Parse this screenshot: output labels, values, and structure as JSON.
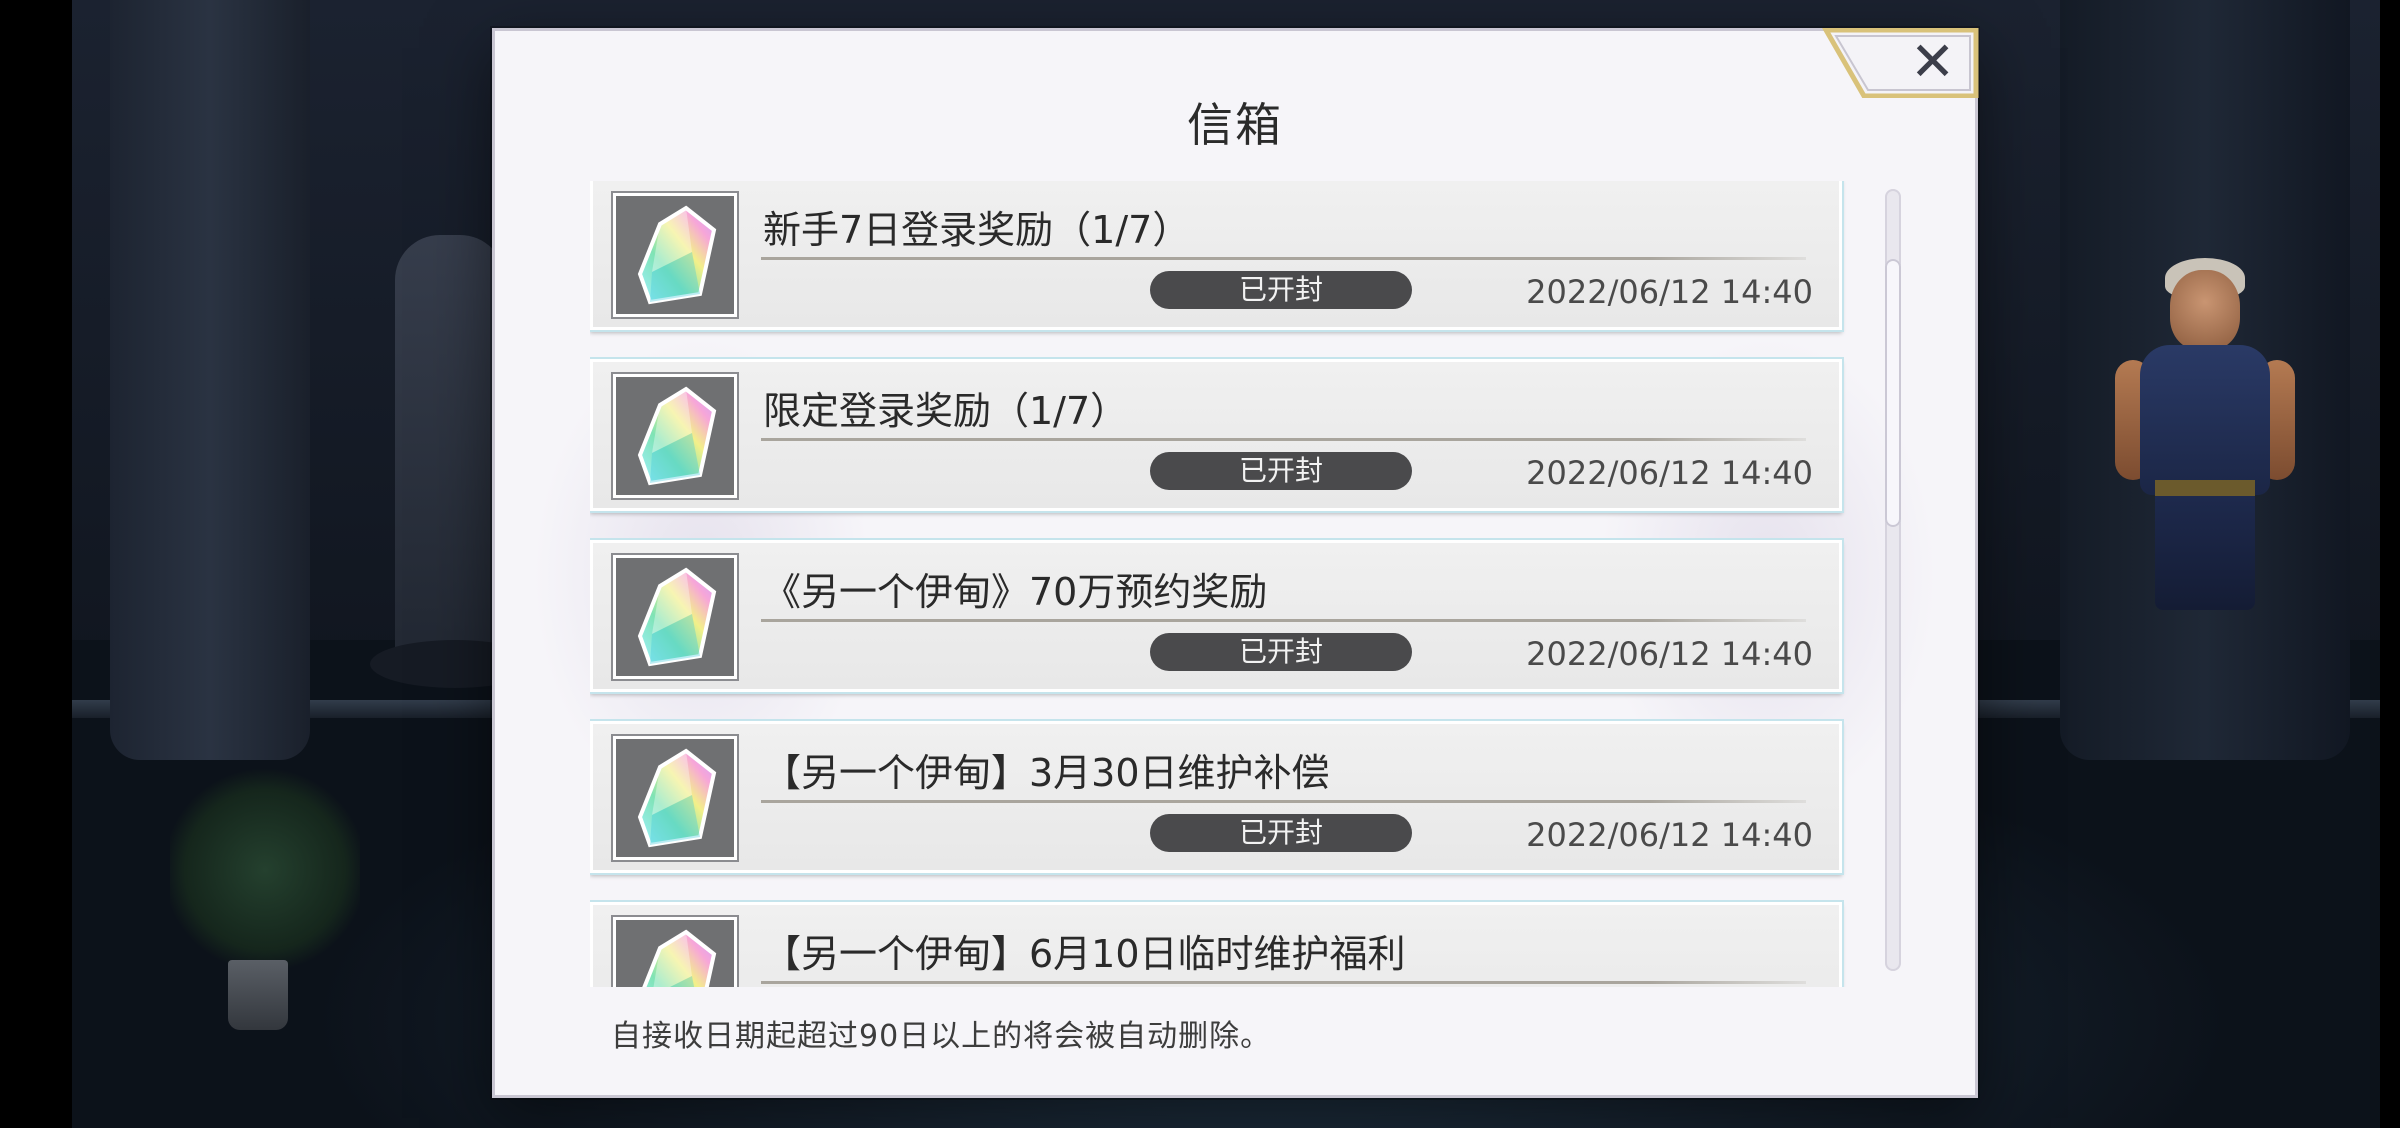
{
  "dialog": {
    "title": "信箱",
    "close_icon": "close-icon",
    "footer_note": "自接收日期起超过90日以上的将会被自动删除。"
  },
  "mail_items": [
    {
      "subject": "新手7日登录奖励（1/7）",
      "status": "已开封",
      "date": "2022/06/12 14:40",
      "icon": "crystal-icon"
    },
    {
      "subject": "限定登录奖励（1/7）",
      "status": "已开封",
      "date": "2022/06/12 14:40",
      "icon": "crystal-icon"
    },
    {
      "subject": "《另一个伊甸》70万预约奖励",
      "status": "已开封",
      "date": "2022/06/12 14:40",
      "icon": "crystal-icon"
    },
    {
      "subject": "【另一个伊甸】3月30日维护补偿",
      "status": "已开封",
      "date": "2022/06/12 14:40",
      "icon": "crystal-icon"
    },
    {
      "subject": "【另一个伊甸】6月10日临时维护福利",
      "status": "",
      "date": "",
      "icon": "crystal-icon"
    }
  ],
  "colors": {
    "dialog_bg": "#f6f5f9",
    "status_badge_bg": "#4a4a4c",
    "item_outline": "#c5e4ec",
    "close_frame": "#d9c27a"
  }
}
